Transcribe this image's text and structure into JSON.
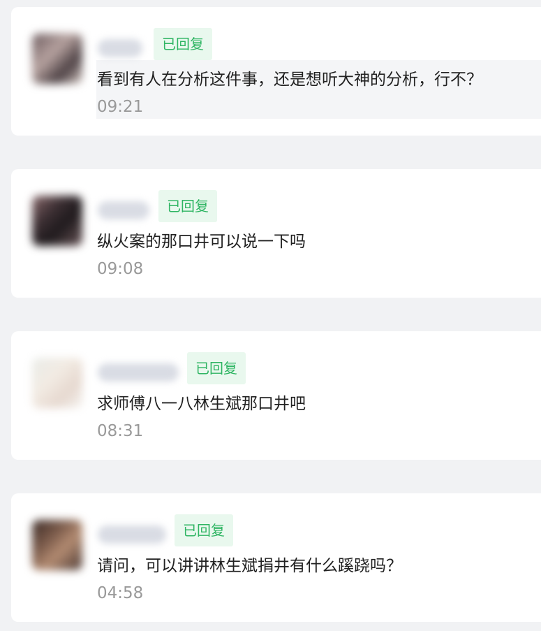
{
  "messages": [
    {
      "badge": "已回复",
      "text": "看到有人在分析这件事，还是想听大神的分析，行不？",
      "time": "09:21"
    },
    {
      "badge": "已回复",
      "text": "纵火案的那口井可以说一下吗",
      "time": "09:08"
    },
    {
      "badge": "已回复",
      "text": "求师傅八一八林生斌那口井吧",
      "time": "08:31"
    },
    {
      "badge": "已回复",
      "text": "请问，可以讲讲林生斌捐井有什么蹊跷吗？",
      "time": "04:58"
    }
  ],
  "colors": {
    "badge_text": "#2fb563",
    "badge_bg": "#e9f8ee",
    "time_text": "#999999",
    "page_bg": "#f1f2f4"
  }
}
